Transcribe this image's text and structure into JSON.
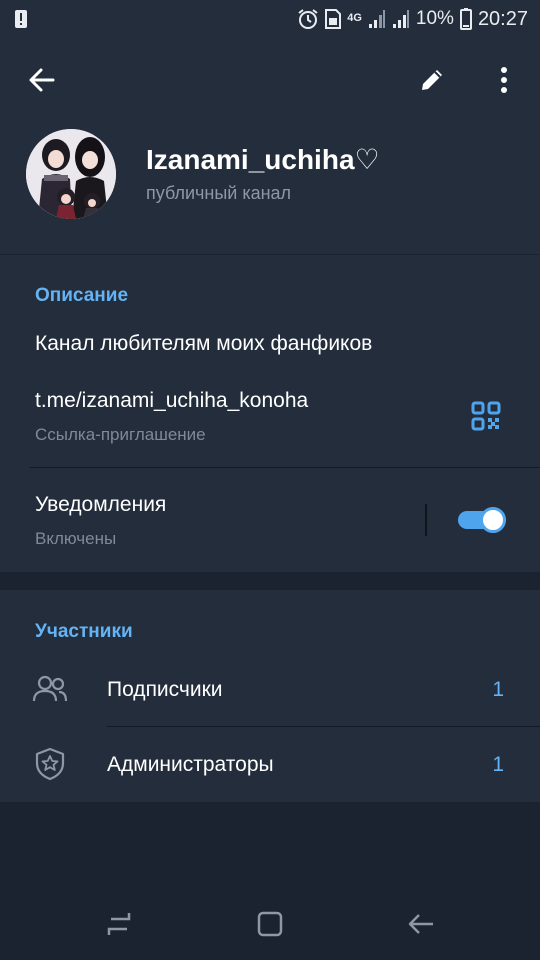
{
  "status_bar": {
    "signal_label": "4G",
    "battery_percent": "10%",
    "time": "20:27"
  },
  "channel": {
    "name": "Izanami_uchiha♡",
    "type": "публичный канал"
  },
  "info": {
    "section_title": "Описание",
    "description": "Канал любителям моих фанфиков",
    "link": "t.me/izanami_uchiha_konoha",
    "link_caption": "Ссылка-приглашение",
    "notifications_label": "Уведомления",
    "notifications_state": "Включены",
    "notifications_on": true
  },
  "members": {
    "section_title": "Участники",
    "items": [
      {
        "label": "Подписчики",
        "count": "1",
        "icon": "people-icon"
      },
      {
        "label": "Администраторы",
        "count": "1",
        "icon": "shield-star-icon"
      }
    ]
  },
  "colors": {
    "accent": "#64b3f4",
    "panel": "#232d3c",
    "background": "#1b2230"
  }
}
